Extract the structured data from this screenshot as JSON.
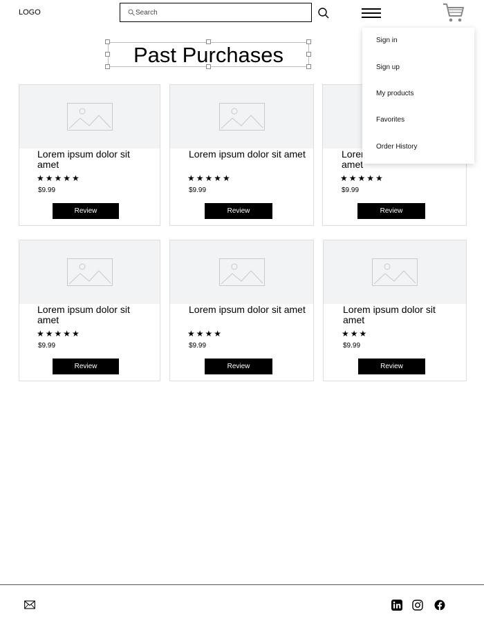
{
  "header": {
    "logo": "LOGO",
    "search_placeholder": "Search"
  },
  "menu": [
    "Sign in",
    "Sign up",
    "My products",
    "Favorites",
    "Order History"
  ],
  "page": {
    "title": "Past Purchases"
  },
  "products": [
    {
      "name": "Lorem ipsum dolor sit amet",
      "stars": "★★★★★",
      "rating": 5,
      "price": "$9.99",
      "button": "Review"
    },
    {
      "name": "Lorem ipsum dolor sit amet",
      "stars": "★★★★★",
      "rating": 5,
      "price": "$9.99",
      "button": "Review"
    },
    {
      "name": "Lorem ipsum dolor sit amet",
      "stars": "★★★★★",
      "rating": 5,
      "price": "$9.99",
      "button": "Review"
    },
    {
      "name": "Lorem ipsum dolor sit amet",
      "stars": "★★★★★",
      "rating": 5,
      "price": "$9.99",
      "button": "Review"
    },
    {
      "name": "Lorem ipsum dolor sit amet",
      "stars": "★★★★",
      "rating": 4,
      "price": "$9.99",
      "button": "Review"
    },
    {
      "name": "Lorem ipsum dolor sit amet",
      "stars": "★★★",
      "rating": 3,
      "price": "$9.99",
      "button": "Review"
    }
  ],
  "footer": {
    "icons": [
      "mail-icon",
      "linkedin-icon",
      "instagram-icon",
      "facebook-icon"
    ]
  },
  "colors": {
    "accent": "#000000",
    "image_placeholder": "#f2f3f5"
  }
}
